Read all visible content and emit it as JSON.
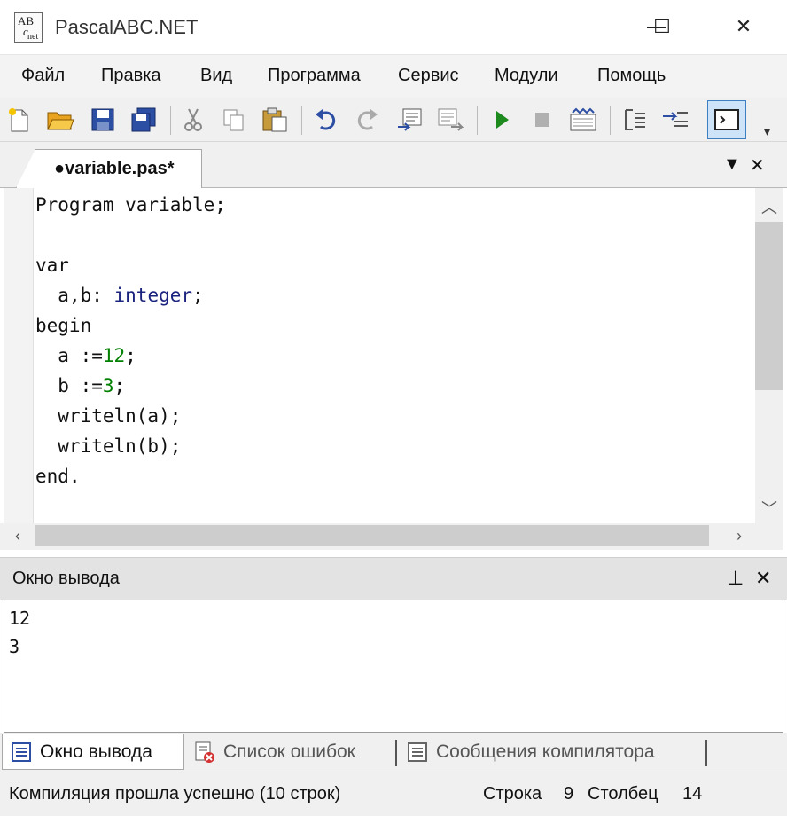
{
  "window": {
    "title": "PascalABC.NET",
    "minimize": "—",
    "maximize": "☐",
    "close": "✕"
  },
  "menu": [
    "Файл",
    "Правка",
    "Вид",
    "Программа",
    "Сервис",
    "Модули",
    "Помощь"
  ],
  "toolbar": {
    "icons": [
      "new-file-icon",
      "open-folder-icon",
      "save-icon",
      "save-all-icon",
      "cut-icon",
      "copy-icon",
      "paste-icon",
      "undo-icon",
      "redo-icon",
      "format-icon",
      "debug-icon",
      "run-icon",
      "stop-icon",
      "compile-icon",
      "step-into-icon",
      "step-over-icon",
      "console-icon"
    ]
  },
  "editor": {
    "tab_label": "●variable.pas*",
    "tab_dropdown": "▼",
    "tab_close": "✕",
    "lines": [
      "Program variable;",
      "",
      "var",
      "  a,b: integer;",
      "begin",
      "  a :=12;",
      "  b :=3;",
      "  writeln(a);",
      "  writeln(b);",
      "end."
    ]
  },
  "output_panel": {
    "title": "Окно вывода",
    "pin": "⊥",
    "close": "✕",
    "lines": [
      "12",
      "3"
    ]
  },
  "bottom_tabs": [
    {
      "label": "Окно вывода",
      "active": true
    },
    {
      "label": "Список ошибок",
      "active": false
    },
    {
      "label": "Сообщения компилятора",
      "active": false
    }
  ],
  "status": {
    "message": "Компиляция прошла успешно (10 строк)",
    "line_label": "Строка",
    "line_value": "9",
    "col_label": "Столбец",
    "col_value": "14"
  }
}
